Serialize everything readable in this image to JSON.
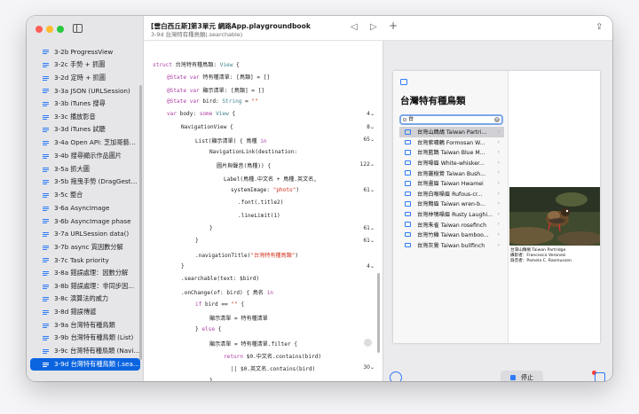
{
  "window": {
    "title": "[雲白西丘斯]第3單元 網路App.playgroundbook",
    "subtitle": "3-9d 台灣特有種鳥類(.searchable)"
  },
  "sidebar": {
    "items": [
      {
        "label": "3-2b ProgressView"
      },
      {
        "label": "3-2c 手勢 + 抓圖"
      },
      {
        "label": "3-2d 定時 + 抓圖"
      },
      {
        "label": "3-3a JSON (URLSession)"
      },
      {
        "label": "3-3b iTunes 搜尋"
      },
      {
        "label": "3-3c 播放影音"
      },
      {
        "label": "3-3d iTunes 試聽"
      },
      {
        "label": "3-4a Open API: 芝加哥藝術..."
      },
      {
        "label": "3-4b 搜尋顯示作品圖片"
      },
      {
        "label": "3-5a 抓大圖"
      },
      {
        "label": "3-5b 拖曳手勢 (DragGesture)"
      },
      {
        "label": "3-5c 整合"
      },
      {
        "label": "3-6a AsyncImage"
      },
      {
        "label": "3-6b AsyncImage phase"
      },
      {
        "label": "3-7a URLSession data()"
      },
      {
        "label": "3-7b async 質因數分解"
      },
      {
        "label": "3-7c Task priority"
      },
      {
        "label": "3-8a 錯誤處理：因數分解"
      },
      {
        "label": "3-8b 錯誤處理：非同步因..."
      },
      {
        "label": "3-8c 演算法的威力"
      },
      {
        "label": "3-8d 錯誤傳遞"
      },
      {
        "label": "3-9a 台灣特有種鳥類"
      },
      {
        "label": "3-9b 台灣特有種鳥類 (List)"
      },
      {
        "label": "3-9c 台灣特有種鳥類 (Navi..."
      },
      {
        "label": "3-9d 台灣特有種鳥類 (.sear..."
      }
    ]
  },
  "code": {
    "lines": [
      {
        "text": "struct 台灣特有種鳥類: View {",
        "badge": ""
      },
      {
        "text": "@State var 特有種清單: [鳥類] = []",
        "badge": ""
      },
      {
        "text": "@State var 顯示清單: [鳥類] = []",
        "badge": ""
      },
      {
        "text": "@State var bird: String = \"\"",
        "badge": ""
      },
      {
        "text": "var body: some View {",
        "badge": "4⌄"
      },
      {
        "text": "NavigationView {",
        "badge": "8⌄"
      },
      {
        "text": "List(顯示清單) { 鳥種 in",
        "badge": "65⌄"
      },
      {
        "text": "NavigationLink(destination:",
        "badge": ""
      },
      {
        "text": "圖片與聲音(鳥種)) {",
        "badge": "122⌄"
      },
      {
        "text": "Label(鳥種.中文名 + 鳥種.英文名,",
        "badge": ""
      },
      {
        "text": "systemImage: \"photo\")",
        "badge": "61⌄"
      },
      {
        "text": ".font(.title2)",
        "badge": ""
      },
      {
        "text": ".lineLimit(1)",
        "badge": ""
      },
      {
        "text": "}",
        "badge": "61⌄"
      },
      {
        "text": "}",
        "badge": "61⌄"
      },
      {
        "text": ".navigationTitle(\"台灣特有種鳥類\")",
        "badge": ""
      },
      {
        "text": "}",
        "badge": "4⌄"
      },
      {
        "text": ".searchable(text: $bird)",
        "badge": ""
      },
      {
        "text": ".onChange(of: bird) { 鳥名 in",
        "badge": ""
      },
      {
        "text": "if bird == \"\" {",
        "badge": ""
      },
      {
        "text": "顯示清單 = 特有種清單",
        "badge": ""
      },
      {
        "text": "} else {",
        "badge": ""
      },
      {
        "text": "顯示清單 = 特有種清單.filter {",
        "badge": ""
      },
      {
        "text": "return $0.中文名.contains(bird)",
        "badge": ""
      },
      {
        "text": "|| $0.英文名.contains(bird)",
        "badge": "30⌄"
      },
      {
        "text": "}",
        "badge": ""
      },
      {
        "text": "}",
        "badge": ""
      }
    ]
  },
  "preview": {
    "nav_title": "台灣特有種鳥類",
    "search_query": "台",
    "birds": [
      {
        "name": "台灣山鷓鴣 Taiwan Partri..."
      },
      {
        "name": "台灣紫嘯鶇 Formosan W..."
      },
      {
        "name": "台灣藍鵲 Taiwan Blue M..."
      },
      {
        "name": "台灣噪眉 White-whisker..."
      },
      {
        "name": "台灣叢樹鶯 Taiwan Bush..."
      },
      {
        "name": "台灣畫眉 Taiwan Hwamei"
      },
      {
        "name": "台灣白喉噪眉 Rufous-cr..."
      },
      {
        "name": "台灣鷦眉 Taiwan wren-b..."
      },
      {
        "name": "台灣林鴝噪眉 Rusty Laughi..."
      },
      {
        "name": "台灣朱雀 Taiwan rosefinch"
      },
      {
        "name": "台灣竹雞 Taiwan bamboo..."
      },
      {
        "name": "台灣灰鷽 Taiwan bullfinch"
      }
    ],
    "caption_title": "台灣山鷓鴣 Taiwan Partridge",
    "caption_photographer": "攝影者：Francesco Veronesi",
    "caption_recorder": "錄音者：Pamela C. Rasmussen",
    "stop_label": "停止"
  },
  "colors": {
    "accent": "#2f7cf6",
    "selection": "#0a64e0",
    "keyword": "#ad3da4",
    "type": "#3e8087",
    "string": "#d12f1b"
  },
  "icons": [
    "sidebar-toggle-icon",
    "back-icon",
    "play-icon",
    "add-icon",
    "share-icon",
    "search-icon",
    "clear-icon",
    "photo-icon",
    "chevron-right-icon",
    "gauge-icon",
    "stop-icon",
    "inspector-icon"
  ]
}
